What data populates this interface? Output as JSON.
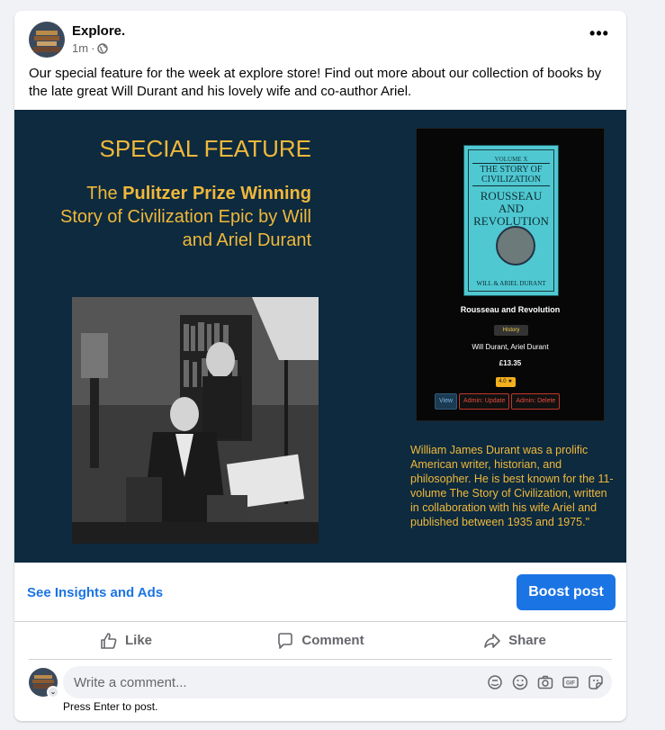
{
  "post": {
    "page_name": "Explore.",
    "time": "1m",
    "separator": "·",
    "text": "Our special feature for the week at explore store! Find out more about our collection of books by the late great Will Durant and his lovely wife and co-author Ariel."
  },
  "image": {
    "heading": "SPECIAL FEATURE",
    "sub_line1_a": "The ",
    "sub_line1_b": "Pulitzer Prize Winning",
    "sub_line2": "Story of Civilization Epic by Will",
    "sub_line3": "and Ariel Durant",
    "cover": {
      "volume": "VOLUME X",
      "series_line1": "THE STORY OF",
      "series_line2": "CIVILIZATION",
      "title_line1": "ROUSSEAU AND",
      "title_line2": "REVOLUTION",
      "authors": "WILL & ARIEL DURANT"
    },
    "product": {
      "title": "Rousseau and Revolution",
      "category": "History",
      "authors": "Will Durant, Ariel Durant",
      "price": "£13.35",
      "rating": "4.0 ★",
      "btn_view": "View",
      "btn_update": "Admin: Update",
      "btn_delete": "Admin: Delete"
    },
    "quote": "William James Durant was a prolific American writer, historian, and philosopher. He is best known for the 11-volume The Story of Civilization, written in collaboration with his wife Ariel and published between 1935 and 1975.\""
  },
  "footer": {
    "insights": "See Insights and Ads",
    "boost": "Boost post"
  },
  "actions": {
    "like": "Like",
    "comment": "Comment",
    "share": "Share"
  },
  "comment": {
    "placeholder": "Write a comment...",
    "hint": "Press Enter to post."
  },
  "colors": {
    "accent": "#1b74e4",
    "image_bg": "#0d2a3f",
    "gold": "#f0b83a"
  }
}
